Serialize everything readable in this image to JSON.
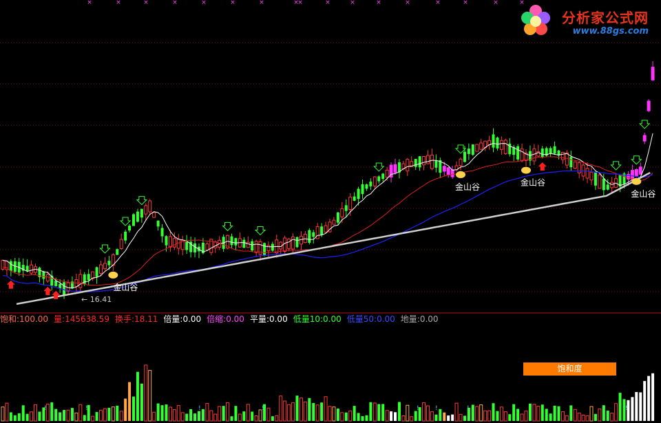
{
  "watermark": {
    "title": "分析家公式网",
    "url": "www.88gs.com",
    "logo_icon": "flower-logo-icon"
  },
  "colors": {
    "background": "#000000",
    "up": "#ff3a3a",
    "down": "#33ff33",
    "strong": "#ff33ff",
    "ma_white": "#ffffff",
    "ma_red": "#e02020",
    "ma_blue": "#2020ff",
    "ma_long": "#d0d0d0",
    "grid": "#7a1a1a",
    "label_yellow": "#ffff44",
    "marker_green": "#33ff33",
    "marker_red": "#ff2020"
  },
  "info_bar": [
    {
      "label": "饱和:",
      "value": "100.00",
      "label_color": "#ff6a4a",
      "value_color": "#ff6a4a"
    },
    {
      "label": "量:",
      "value": "145638.59",
      "label_color": "#ff2a2a",
      "value_color": "#ff2a2a"
    },
    {
      "label": "换手:",
      "value": "18.11",
      "label_color": "#ff2a2a",
      "value_color": "#ff2a2a"
    },
    {
      "label": "倍量:",
      "value": "0.00",
      "label_color": "#ffffff",
      "value_color": "#ffffff"
    },
    {
      "label": "倍缩:",
      "value": "0.00",
      "label_color": "#ff44ff",
      "value_color": "#ff44ff"
    },
    {
      "label": "平量:",
      "value": "0.00",
      "label_color": "#ffffff",
      "value_color": "#ffffff"
    },
    {
      "label": "低量10:",
      "value": "0.00",
      "label_color": "#33ff33",
      "value_color": "#33ff33"
    },
    {
      "label": "低量50:",
      "value": "0.00",
      "label_color": "#3a4aff",
      "value_color": "#3a4aff"
    },
    {
      "label": "地量:",
      "value": "0.00",
      "label_color": "#aaaaaa",
      "value_color": "#aaaaaa"
    }
  ],
  "saturation_label": "饱和度",
  "chart_data": {
    "type": "candlestick",
    "y_min_label": "16.41",
    "signal_label": "金山谷",
    "signals": [
      {
        "index": 27,
        "label": "金山谷"
      },
      {
        "index": 112,
        "label": "金山谷"
      },
      {
        "index": 128,
        "label": "金山谷"
      },
      {
        "index": 155,
        "label": "金山谷"
      }
    ],
    "down_arrows": [
      25,
      30,
      34,
      55,
      63,
      92,
      112,
      150,
      155,
      157
    ],
    "up_arrows": [
      2,
      11,
      13,
      132
    ]
  }
}
